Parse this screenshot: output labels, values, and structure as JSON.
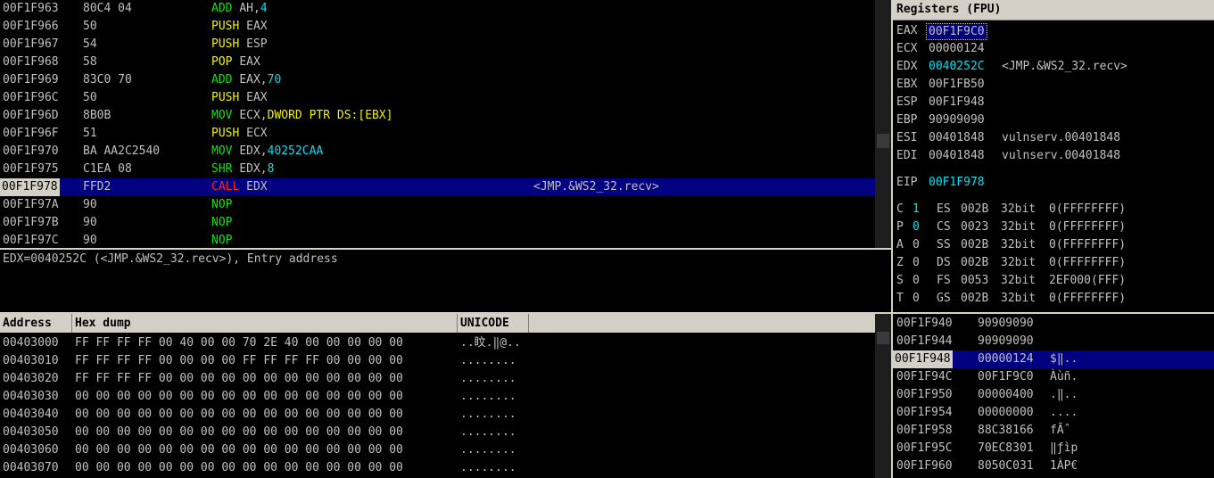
{
  "disasm": {
    "rows": [
      {
        "addr": "00F1F963",
        "hex": "80C4 04",
        "mn": "ADD",
        "ops": [
          {
            "t": "AH,",
            "c": ""
          },
          {
            "t": "4",
            "c": "cyan"
          }
        ],
        "mc": "green",
        "comment": ""
      },
      {
        "addr": "00F1F966",
        "hex": "50",
        "mn": "PUSH",
        "ops": [
          {
            "t": "EAX",
            "c": ""
          }
        ],
        "mc": "yellow",
        "comment": ""
      },
      {
        "addr": "00F1F967",
        "hex": "54",
        "mn": "PUSH",
        "ops": [
          {
            "t": "ESP",
            "c": ""
          }
        ],
        "mc": "yellow",
        "comment": ""
      },
      {
        "addr": "00F1F968",
        "hex": "58",
        "mn": "POP",
        "ops": [
          {
            "t": "EAX",
            "c": ""
          }
        ],
        "mc": "yellow",
        "comment": ""
      },
      {
        "addr": "00F1F969",
        "hex": "83C0 70",
        "mn": "ADD",
        "ops": [
          {
            "t": "EAX,",
            "c": ""
          },
          {
            "t": "70",
            "c": "cyan"
          }
        ],
        "mc": "green",
        "comment": ""
      },
      {
        "addr": "00F1F96C",
        "hex": "50",
        "mn": "PUSH",
        "ops": [
          {
            "t": "EAX",
            "c": ""
          }
        ],
        "mc": "yellow",
        "comment": ""
      },
      {
        "addr": "00F1F96D",
        "hex": "8B0B",
        "mn": "MOV",
        "ops": [
          {
            "t": "ECX,",
            "c": ""
          },
          {
            "t": "DWORD PTR DS:[EBX]",
            "c": "yellow"
          }
        ],
        "mc": "green",
        "comment": ""
      },
      {
        "addr": "00F1F96F",
        "hex": "51",
        "mn": "PUSH",
        "ops": [
          {
            "t": "ECX",
            "c": ""
          }
        ],
        "mc": "yellow",
        "comment": ""
      },
      {
        "addr": "00F1F970",
        "hex": "BA AA2C2540",
        "mn": "MOV",
        "ops": [
          {
            "t": "EDX,",
            "c": ""
          },
          {
            "t": "40252CAA",
            "c": "cyan"
          }
        ],
        "mc": "green",
        "comment": ""
      },
      {
        "addr": "00F1F975",
        "hex": "C1EA 08",
        "mn": "SHR",
        "ops": [
          {
            "t": "EDX,",
            "c": ""
          },
          {
            "t": "8",
            "c": "cyan"
          }
        ],
        "mc": "green",
        "comment": ""
      },
      {
        "addr": "00F1F978",
        "hex": "FFD2",
        "mn": "CALL",
        "ops": [
          {
            "t": "EDX",
            "c": ""
          }
        ],
        "mc": "red",
        "comment": "<JMP.&WS2_32.recv>",
        "selected": true
      },
      {
        "addr": "00F1F97A",
        "hex": "90",
        "mn": "NOP",
        "ops": [],
        "mc": "green",
        "comment": ""
      },
      {
        "addr": "00F1F97B",
        "hex": "90",
        "mn": "NOP",
        "ops": [],
        "mc": "green",
        "comment": ""
      },
      {
        "addr": "00F1F97C",
        "hex": "90",
        "mn": "NOP",
        "ops": [],
        "mc": "green",
        "comment": ""
      }
    ]
  },
  "info": {
    "text": "EDX=0040252C (<JMP.&WS2_32.recv>), Entry address"
  },
  "registers": {
    "title": "Registers (FPU)",
    "gp": [
      {
        "name": "EAX",
        "value": "00F1F9C0",
        "comment": "",
        "highlight": "box"
      },
      {
        "name": "ECX",
        "value": "00000124",
        "comment": ""
      },
      {
        "name": "EDX",
        "value": "0040252C",
        "comment": "<JMP.&WS2_32.recv>",
        "highlight": "cyan"
      },
      {
        "name": "EBX",
        "value": "00F1FB50",
        "comment": ""
      },
      {
        "name": "ESP",
        "value": "00F1F948",
        "comment": ""
      },
      {
        "name": "EBP",
        "value": "90909090",
        "comment": ""
      },
      {
        "name": "ESI",
        "value": "00401848",
        "comment": "vulnserv.00401848"
      },
      {
        "name": "EDI",
        "value": "00401848",
        "comment": "vulnserv.00401848"
      }
    ],
    "eip": {
      "name": "EIP",
      "value": "00F1F978"
    },
    "flags": [
      {
        "f": "C",
        "v": "1",
        "seg": "ES",
        "sel": "002B",
        "bits": "32bit",
        "info": "0(FFFFFFFF)",
        "hl": true
      },
      {
        "f": "P",
        "v": "0",
        "seg": "CS",
        "sel": "0023",
        "bits": "32bit",
        "info": "0(FFFFFFFF)",
        "hl": true
      },
      {
        "f": "A",
        "v": "0",
        "seg": "SS",
        "sel": "002B",
        "bits": "32bit",
        "info": "0(FFFFFFFF)"
      },
      {
        "f": "Z",
        "v": "0",
        "seg": "DS",
        "sel": "002B",
        "bits": "32bit",
        "info": "0(FFFFFFFF)"
      },
      {
        "f": "S",
        "v": "0",
        "seg": "FS",
        "sel": "0053",
        "bits": "32bit",
        "info": "2EF000(FFF)"
      },
      {
        "f": "T",
        "v": "0",
        "seg": "GS",
        "sel": "002B",
        "bits": "32bit",
        "info": "0(FFFFFFFF)"
      }
    ]
  },
  "dump": {
    "headers": {
      "address": "Address",
      "hex": "Hex dump",
      "unicode": "UNICODE"
    },
    "rows": [
      {
        "addr": "00403000",
        "hex": "FF FF FF FF 00 40 00 00 70 2E 40 00 00 00 00 00",
        "text": "..盿.‖@.."
      },
      {
        "addr": "00403010",
        "hex": "FF FF FF FF 00 00 00 00 FF FF FF FF 00 00 00 00",
        "text": "........"
      },
      {
        "addr": "00403020",
        "hex": "FF FF FF FF 00 00 00 00 00 00 00 00 00 00 00 00",
        "text": "........"
      },
      {
        "addr": "00403030",
        "hex": "00 00 00 00 00 00 00 00 00 00 00 00 00 00 00 00",
        "text": "........"
      },
      {
        "addr": "00403040",
        "hex": "00 00 00 00 00 00 00 00 00 00 00 00 00 00 00 00",
        "text": "........"
      },
      {
        "addr": "00403050",
        "hex": "00 00 00 00 00 00 00 00 00 00 00 00 00 00 00 00",
        "text": "........"
      },
      {
        "addr": "00403060",
        "hex": "00 00 00 00 00 00 00 00 00 00 00 00 00 00 00 00",
        "text": "........"
      },
      {
        "addr": "00403070",
        "hex": "00 00 00 00 00 00 00 00 00 00 00 00 00 00 00 00",
        "text": "........"
      }
    ]
  },
  "stack": {
    "rows": [
      {
        "addr": "00F1F940",
        "val": "90909090",
        "text": ""
      },
      {
        "addr": "00F1F944",
        "val": "90909090",
        "text": ""
      },
      {
        "addr": "00F1F948",
        "val": "00000124",
        "text": "$‖..",
        "selected": true
      },
      {
        "addr": "00F1F94C",
        "val": "00F1F9C0",
        "text": "Àùñ."
      },
      {
        "addr": "00F1F950",
        "val": "00000400",
        "text": ".‖.."
      },
      {
        "addr": "00F1F954",
        "val": "00000000",
        "text": "...."
      },
      {
        "addr": "00F1F958",
        "val": "88C38166",
        "text": "fÃˆ"
      },
      {
        "addr": "00F1F95C",
        "val": "70EC8301",
        "text": "‖ƒìp"
      },
      {
        "addr": "00F1F960",
        "val": "8050C031",
        "text": "1ÀP€"
      }
    ]
  }
}
